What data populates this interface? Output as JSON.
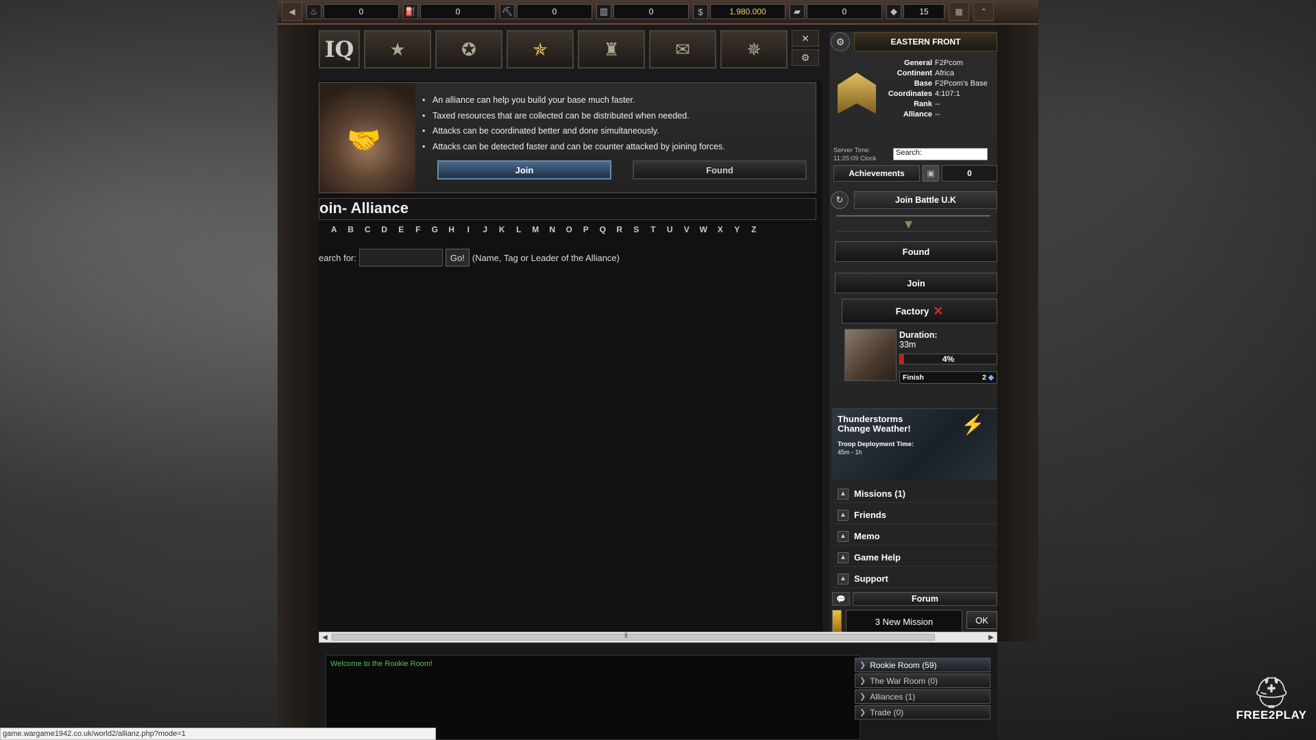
{
  "resources": [
    {
      "icon": "oil-icon",
      "value": "0"
    },
    {
      "icon": "fuel-icon",
      "value": "0"
    },
    {
      "icon": "ore-icon",
      "value": "0"
    },
    {
      "icon": "ammo-icon",
      "value": "0"
    },
    {
      "icon": "money-icon",
      "value": "1.980.000",
      "gold": true
    },
    {
      "icon": "gold-icon",
      "value": "0"
    },
    {
      "icon": "diamond-icon",
      "value": "15"
    }
  ],
  "nav": {
    "hq_label": "IQ",
    "items": [
      "hq",
      "units",
      "map",
      "alliance",
      "buildings",
      "messages",
      "research"
    ]
  },
  "info": {
    "bullets": [
      "An alliance can help you build your base much faster.",
      "Taxed resources that are collected can be distributed when needed.",
      "Attacks can be coordinated better and done simultaneously.",
      "Attacks can be detected faster and can be counter attacked by joining forces."
    ],
    "join_label": "Join",
    "found_label": "Found"
  },
  "page": {
    "title": "oin- Alliance",
    "letters": [
      "A",
      "B",
      "C",
      "D",
      "E",
      "F",
      "G",
      "H",
      "I",
      "J",
      "K",
      "L",
      "M",
      "N",
      "O",
      "P",
      "Q",
      "R",
      "S",
      "T",
      "U",
      "V",
      "W",
      "X",
      "Y",
      "Z"
    ],
    "search_label": "earch for:",
    "search_value": "",
    "go_label": "Go!",
    "search_hint": "(Name, Tag or Leader of the Alliance)"
  },
  "panel": {
    "front": "EASTERN FRONT",
    "general_k": "General",
    "general_v": "F2Pcom",
    "continent_k": "Continent",
    "continent_v": "Africa",
    "base_k": "Base",
    "base_v": "F2Pcom's Base",
    "coords_k": "Coordinates",
    "coords_v": "4:107:1",
    "rank_k": "Rank",
    "rank_v": "--",
    "alliance_k": "Alliance",
    "alliance_v": "--",
    "server_time_label": "Server Time:",
    "server_time": "11:25:09 Clock",
    "search_value": "Search:",
    "achievements_label": "Achievements",
    "achievements_count": "0",
    "battle_label": "Join Battle U.K",
    "found_label": "Found",
    "join_label": "Join",
    "factory_label": "Factory",
    "duration_label": "Duration:",
    "duration_value": "33m",
    "progress_pct": "4%",
    "progress_fraction": 0.04,
    "finish_label": "Finish",
    "finish_cost": "2",
    "weather_title1": "Thunderstorms",
    "weather_title2": "Change Weather!",
    "weather_sub": "Troop Deployment Time:",
    "weather_time": "45m - 1h",
    "menu": [
      "Missions (1)",
      "Friends",
      "Memo",
      "Game Help",
      "Support"
    ],
    "forum_label": "Forum",
    "new_mission": "3 New Mission",
    "ok_label": "OK"
  },
  "chat": {
    "welcome": "Welcome to the Rookie Room!",
    "rooms": [
      "Rookie Room (59)",
      "The War Room (0)",
      "Alliances (1)",
      "Trade (0)"
    ]
  },
  "status_url": "game.wargame1942.co.uk/world2/allianz.php?mode=1",
  "brand": "FREE2PLAY"
}
